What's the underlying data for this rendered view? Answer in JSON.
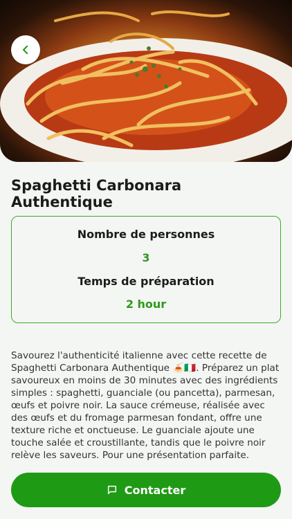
{
  "recipe": {
    "title": "Spaghetti Carbonara Authentique",
    "servings_label": "Nombre de personnes",
    "servings_value": "3",
    "prep_label": "Temps de préparation",
    "prep_value": "2 hour",
    "description": "Savourez l'authenticité italienne avec cette recette de Spaghetti Carbonara Authentique 🍝🇮🇹. Préparez un plat savoureux en moins de 30 minutes avec des ingrédients simples : spaghetti, guanciale (ou pancetta), parmesan, œufs et poivre noir. La sauce crémeuse, réalisée avec des œufs et du fromage parmesan fondant, offre une texture riche et onctueuse. Le guanciale ajoute une touche salée et croustillante, tandis que le poivre noir relève les saveurs. Pour une présentation parfaite."
  },
  "actions": {
    "contact_label": "Contacter"
  },
  "icons": {
    "back": "chevron-left-icon",
    "contact": "message-square-icon"
  },
  "colors": {
    "accent": "#1f9a14",
    "value_green": "#2e9a1c",
    "card_border": "#3fa82a"
  }
}
